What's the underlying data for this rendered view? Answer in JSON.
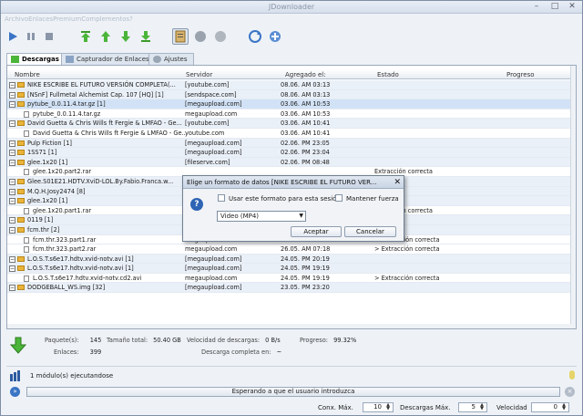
{
  "window": {
    "title": "JDownloader"
  },
  "menubar": {
    "text": "ArchivoEnlacesPremiumComplementos?"
  },
  "tabs": [
    {
      "label": "Descargas"
    },
    {
      "label": "Capturador de Enlaces"
    },
    {
      "label": "Ajustes"
    }
  ],
  "columns": {
    "name": "Nombre",
    "server": "Servidor",
    "added": "Agregado el:",
    "state": "Estado",
    "progress": "Progreso"
  },
  "rows": [
    {
      "type": "pkg",
      "name": "NIKE ESCRIBE EL FUTURO  VERSIÓN COMPLETA(...",
      "server": "[youtube.com]",
      "added": "08.06. AM 03:13",
      "state": "",
      "progress": "29.61 MB/29.61 MB"
    },
    {
      "type": "pkg",
      "name": "[NSnF] Fullmetal Alchemist Cap. 107 [HQ] [1]",
      "server": "[sendspace.com]",
      "added": "08.06. AM 03:13",
      "state": "",
      "progress": "44.16 MB/44.16 MB"
    },
    {
      "type": "pkg",
      "name": "pytube_0.0.11.4.tar.gz [1]",
      "server": "[megaupload.com]",
      "added": "03.06. AM 10:53",
      "state": "",
      "progress": "1.16 MB/1.16 MB"
    },
    {
      "type": "file",
      "name": "pytube_0.0.11.4.tar.gz",
      "server": "megaupload.com",
      "added": "03.06. AM 10:53",
      "state": "",
      "progress": "1.16 MB"
    },
    {
      "type": "pkg",
      "name": "David Guetta & Chris Wills ft Fergie & LMFAO - Ge...",
      "server": "[youtube.com]",
      "added": "03.06. AM 10:41",
      "state": "",
      "progress": "29.61 MB/29.61 MB"
    },
    {
      "type": "file",
      "name": "David Guetta & Chris Wills ft Fergie & LMFAO - Ge...",
      "server": "youtube.com",
      "added": "03.06. AM 10:41",
      "state": "",
      "progress": "29.61 MB"
    },
    {
      "type": "pkg",
      "name": "Pulp Fiction [1]",
      "server": "[megaupload.com]",
      "added": "02.06. PM 23:05",
      "state": "",
      "progress": "646.12 MB/646.12 MB"
    },
    {
      "type": "pkg",
      "name": "1SS71 [1]",
      "server": "[megaupload.com]",
      "added": "02.06. PM 23:04",
      "state": "",
      "progress": "52.45 KB/52.45 KB"
    },
    {
      "type": "pkg",
      "name": "glee.1x20 [1]",
      "server": "[fileserve.com]",
      "added": "02.06. PM 08:48",
      "state": "",
      "progress": "159.78 MB/159.78 MB"
    },
    {
      "type": "file",
      "name": "glee.1x20.part2.rar",
      "server": "",
      "added": "",
      "state": "Extracción correcta",
      "progress": "159.78 MB"
    },
    {
      "type": "pkg",
      "name": "Glee.S01E21.HDTV.XviD-LOL.By.Fabio.Franca.w...",
      "server": "[megaupload.com]",
      "added": "",
      "state": "",
      "progress": "349.70 MB/349.70 MB"
    },
    {
      "type": "pkg",
      "name": "M.Q.H.Josy2474 [8]",
      "server": "[megaupload.com]",
      "added": "",
      "state": "",
      "progress": "700.27 MB/700.27 MB"
    },
    {
      "type": "pkg",
      "name": "glee.1x20 [1]",
      "server": "[megaupload.com]",
      "added": "",
      "state": "",
      "progress": "190.00 MB/190.00 MB"
    },
    {
      "type": "file",
      "name": "glee.1x20.part1.rar",
      "server": "",
      "added": "",
      "state": "Extracción correcta",
      "progress": "190.00 MB"
    },
    {
      "type": "pkg",
      "name": "0119 [1]",
      "server": "[hotfile.com]",
      "added": "27.05. AM 01:23",
      "state": "",
      "progress": "347.07 MB/347.07 MB"
    },
    {
      "type": "pkg",
      "name": "fcm.thr [2]",
      "server": "[megaupload.com]",
      "added": "26.05. AM 07:18",
      "state": "",
      "progress": "175.27 MB/175.27 MB"
    },
    {
      "type": "file",
      "name": "fcm.thr.323.part1.rar",
      "server": "megaupload.com",
      "added": "26.05. AM 07:18",
      "state": "> Extracción correcta",
      "progress": "100.00 MB"
    },
    {
      "type": "file",
      "name": "fcm.thr.323.part2.rar",
      "server": "megaupload.com",
      "added": "26.05. AM 07:18",
      "state": "> Extracción correcta",
      "progress": "75.27 MB"
    },
    {
      "type": "pkg",
      "name": "L.O.S.T.s6e17.hdtv.xvid-notv.avi [1]",
      "server": "[megaupload.com]",
      "added": "24.05. PM 20:19",
      "state": "",
      "progress": "698.37 MB/698.37 MB"
    },
    {
      "type": "pkg",
      "name": "L.O.S.T.s6e17.hdtv.xvid-notv.avi [1]",
      "server": "[megaupload.com]",
      "added": "24.05. PM 19:19",
      "state": "",
      "progress": "697.69 MB/697.69 MB"
    },
    {
      "type": "file",
      "name": "L.O.S.T.s6e17.hdtv.xvid-notv.cd2.avi",
      "server": "megaupload.com",
      "added": "24.05. PM 19:19",
      "state": "> Extracción correcta",
      "progress": "697.69 MB"
    },
    {
      "type": "pkg",
      "name": "DODGEBALL_WS.img [32]",
      "server": "[megaupload.com]",
      "added": "23.05. PM 23:20",
      "state": "",
      "progress": "4.34 GB/4.34 GB"
    }
  ],
  "stats": {
    "packages_label": "Paquete(s):",
    "packages": "145",
    "total_label": "Tamaño total:",
    "total": "50.40 GB",
    "speed_label": "Velocidad de descargas:",
    "speed": "0 B/s",
    "progress_label": "Progreso:",
    "progress": "99.32%",
    "links_label": "Enlaces:",
    "links": "399",
    "eta_label": "Descarga completa en:",
    "eta": "~"
  },
  "modules": {
    "text": "1 módulo(s) ejecutandose"
  },
  "status": {
    "text": "Esperando a que el usuario introduzca"
  },
  "bottom": {
    "conx_label": "Conx. Máx.",
    "conx": "10",
    "downloads_label": "Descargas Máx.",
    "downloads": "5",
    "speed_label": "Velocidad",
    "speed": "0"
  },
  "dialog": {
    "title": "Elige un formato de datos [NIKE ESCRIBE EL FUTURO  VER...",
    "use_format": "Usar este formato para esta sesión",
    "keep_force": "Mantener fuerza",
    "select_value": "Video (MP4)",
    "accept": "Aceptar",
    "cancel": "Cancelar"
  },
  "colors": {
    "accent": "#3d7ac7",
    "progress_green": "#4fb23b",
    "ok": "#3aa33a"
  }
}
